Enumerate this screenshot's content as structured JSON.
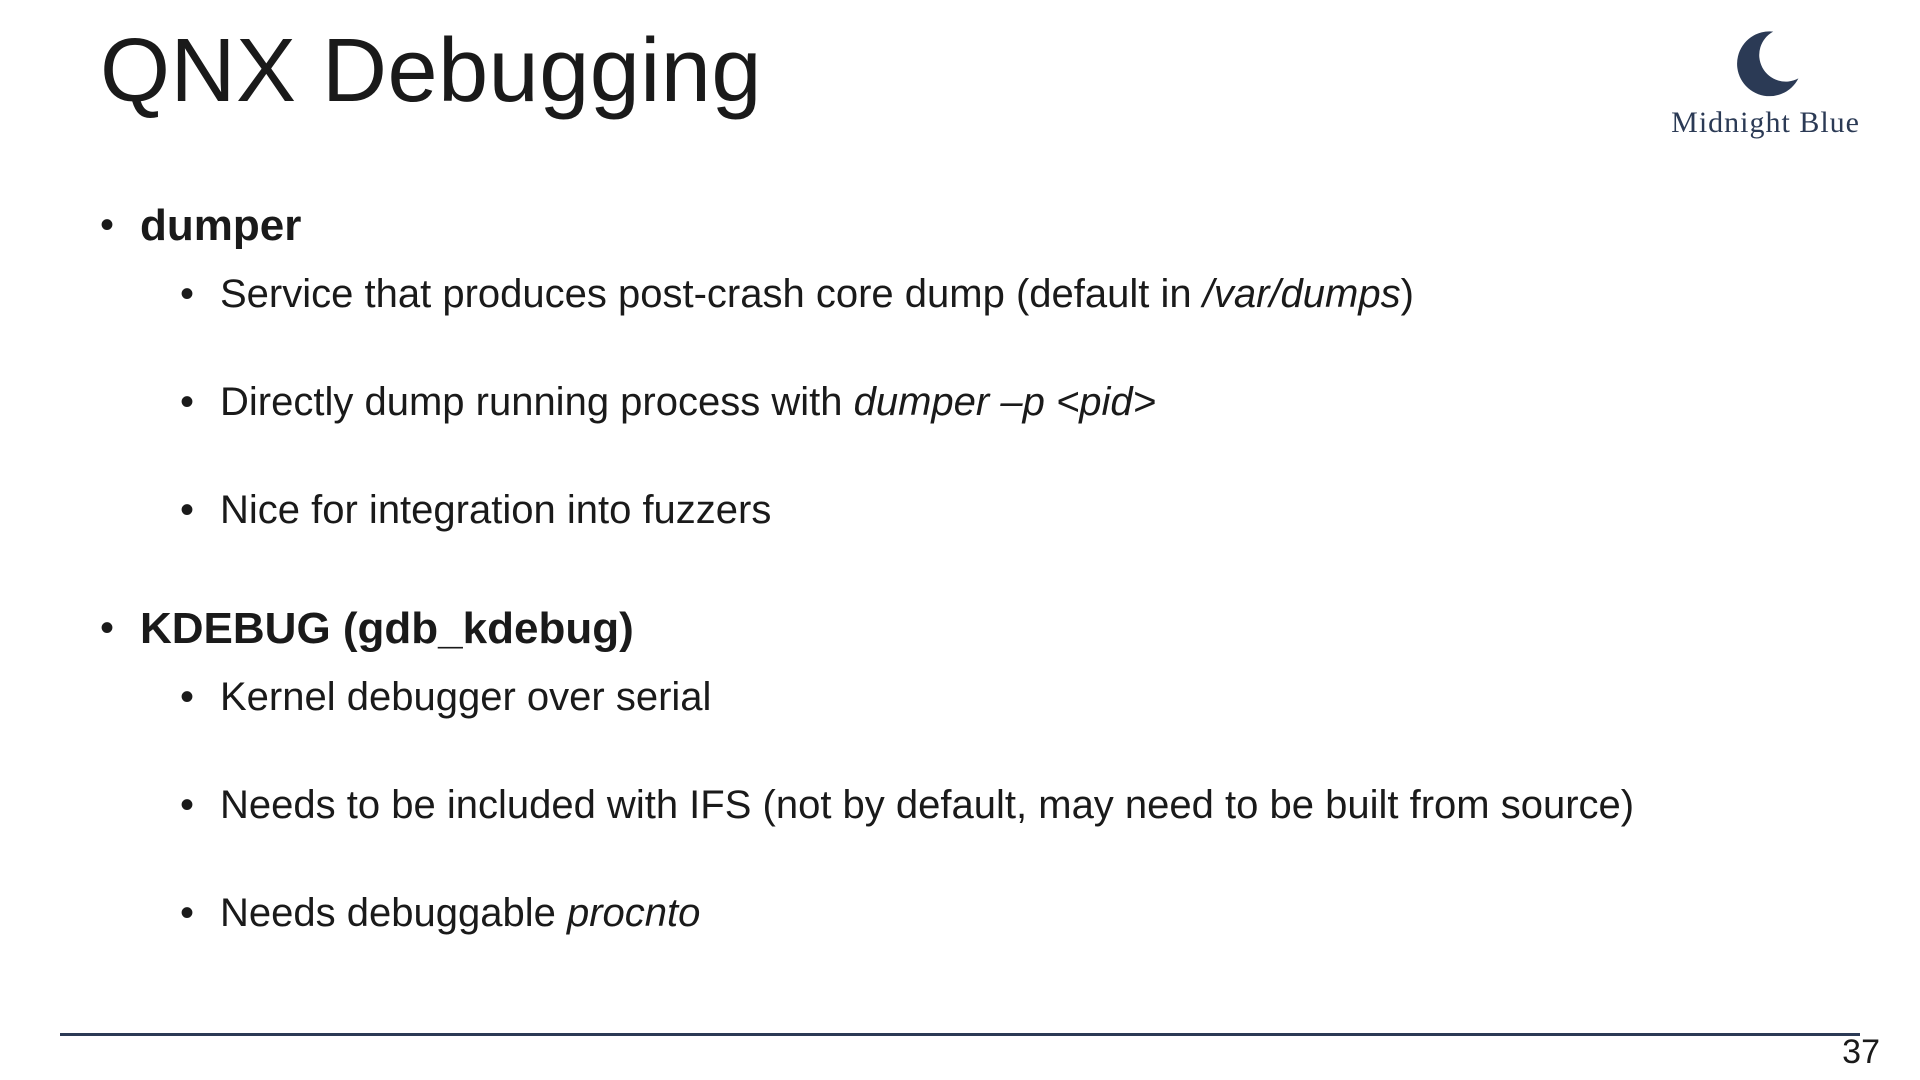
{
  "title": "QNX Debugging",
  "logo": {
    "text": "Midnight Blue",
    "color": "#2b3a55"
  },
  "sections": [
    {
      "heading": "dumper",
      "items": [
        {
          "prefix": "Service that produces post-crash core dump (default in ",
          "italic": "/var/dumps",
          "suffix": ")"
        },
        {
          "prefix": "Directly dump running process with ",
          "italic": "dumper –p <pid>",
          "suffix": ""
        },
        {
          "prefix": "Nice for integration into fuzzers",
          "italic": "",
          "suffix": ""
        }
      ]
    },
    {
      "heading": "KDEBUG (gdb_kdebug)",
      "items": [
        {
          "prefix": "Kernel debugger over serial",
          "italic": "",
          "suffix": ""
        },
        {
          "prefix": "Needs to be included with IFS (not by default, may need to be built from source)",
          "italic": "",
          "suffix": ""
        },
        {
          "prefix": "Needs debuggable ",
          "italic": "procnto",
          "suffix": ""
        }
      ]
    }
  ],
  "page_number": "37"
}
